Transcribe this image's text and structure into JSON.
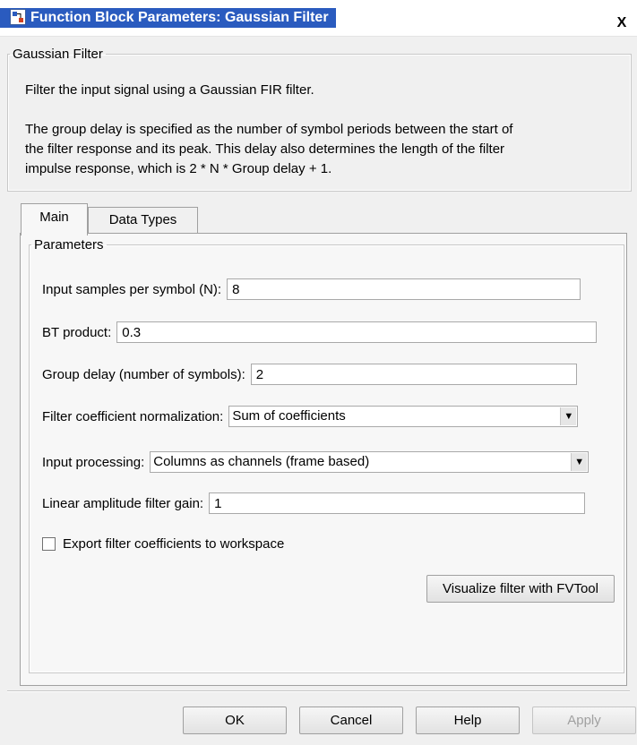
{
  "window": {
    "title": "Function Block Parameters: Gaussian Filter",
    "close_symbol": "X",
    "icon": "simulink-block-icon"
  },
  "description": {
    "group_label": "Gaussian Filter",
    "line1": "Filter the input signal using a Gaussian FIR filter.",
    "line2": "The group delay is specified as the number of symbol periods between the start of",
    "line3": "the filter response and its peak. This delay also determines the length of the filter",
    "line4": "impulse response, which is 2 * N * Group delay + 1."
  },
  "tabs": [
    {
      "label": "Main",
      "active": true
    },
    {
      "label": "Data Types",
      "active": false
    }
  ],
  "parameters": {
    "group_label": "Parameters",
    "samples_per_symbol": {
      "label": "Input samples per symbol (N):",
      "value": "8"
    },
    "bt_product": {
      "label": "BT product:",
      "value": "0.3"
    },
    "group_delay": {
      "label": "Group delay (number of symbols):",
      "value": "2"
    },
    "normalization": {
      "label": "Filter coefficient normalization:",
      "value": "Sum of coefficients"
    },
    "input_processing": {
      "label": "Input processing:",
      "value": "Columns as channels (frame based)"
    },
    "filter_gain": {
      "label": "Linear amplitude filter gain:",
      "value": "1"
    },
    "export_coefficients": {
      "label": "Export filter coefficients to workspace",
      "checked": false
    },
    "visualize_button": "Visualize filter with FVTool"
  },
  "footer": {
    "ok": "OK",
    "cancel": "Cancel",
    "help": "Help",
    "apply": "Apply"
  }
}
